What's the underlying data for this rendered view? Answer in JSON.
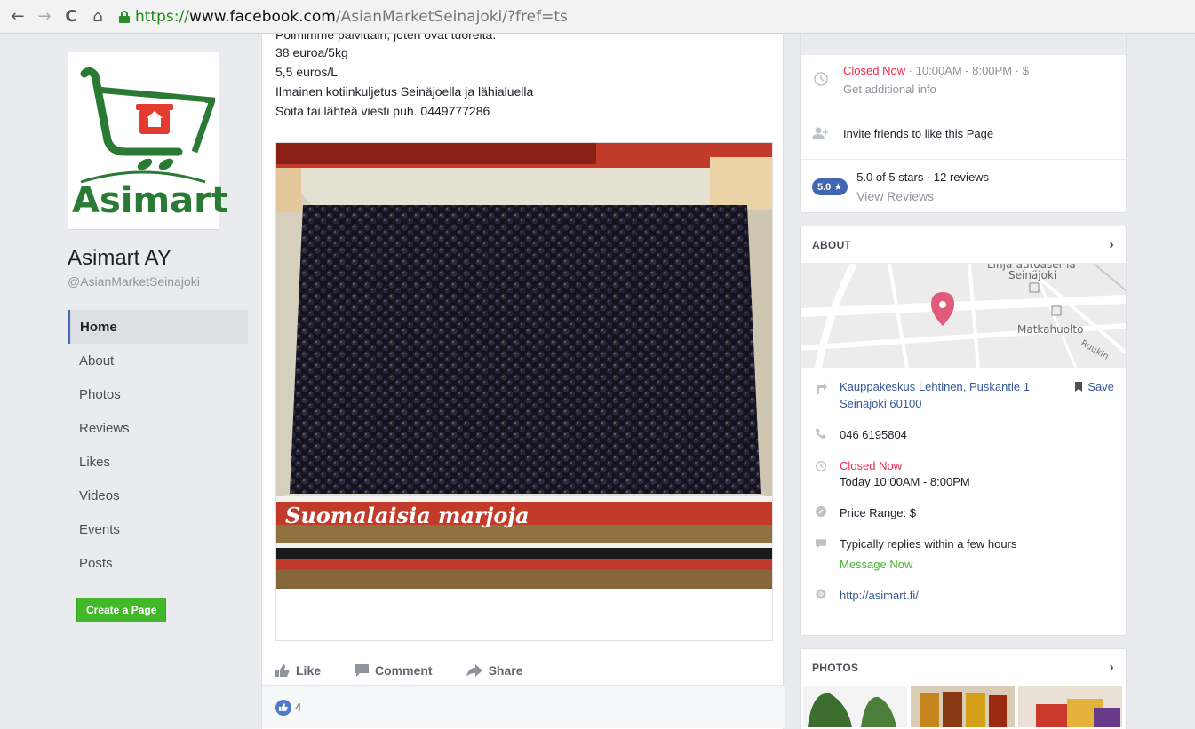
{
  "browser": {
    "back_icon": "arrow-left-icon",
    "url_scheme": "https://",
    "url_host": "www.facebook.com",
    "url_path": "/AsianMarketSeinajoki/?fref=ts"
  },
  "page": {
    "logo_text": "Asimart",
    "name": "Asimart AY",
    "handle": "@AsianMarketSeinajoki"
  },
  "nav": {
    "items": [
      "Home",
      "About",
      "Photos",
      "Reviews",
      "Likes",
      "Videos",
      "Events",
      "Posts"
    ],
    "create_page": "Create a Page"
  },
  "post": {
    "cut_line": "Poimimme päivittäin, joten ovat tuoreita.",
    "lines": [
      "38 euroa/5kg",
      "5,5 euros/L",
      "Ilmainen kotiinkuljetus Seinäjoella ja lähialuella",
      "Soita tai lähteä viesti puh. 0449777286"
    ],
    "box_text": "Suomalaisia marjoja",
    "actions": {
      "like": "Like",
      "comment": "Comment",
      "share": "Share"
    },
    "like_count": "4"
  },
  "sidebar": {
    "status_closed": "Closed Now",
    "status_hours": " · 10:00AM - 8:00PM · $",
    "additional_info": "Get additional info",
    "invite": "Invite friends to like this Page",
    "rating_badge": "5.0 ★",
    "rating_text": "5.0 of 5 stars · 12 reviews",
    "view_reviews": "View Reviews",
    "about": {
      "title": "ABOUT",
      "map_labels": {
        "station1": "Linja-autoasema",
        "station2": "Seinäjoki",
        "matka": "Matkahuolto",
        "street": "Ruukin"
      },
      "address_line1": "Kauppakeskus Lehtinen, Puskantie 1",
      "address_line2": "Seinäjoki 60100",
      "save": "Save",
      "phone": "046 6195804",
      "closed_now": "Closed Now",
      "today_hours": "Today 10:00AM - 8:00PM",
      "price_range": "Price Range: $",
      "replies": "Typically replies within a few hours",
      "message_now": "Message Now",
      "website": "http://asimart.fi/"
    },
    "photos": {
      "title": "PHOTOS"
    }
  }
}
